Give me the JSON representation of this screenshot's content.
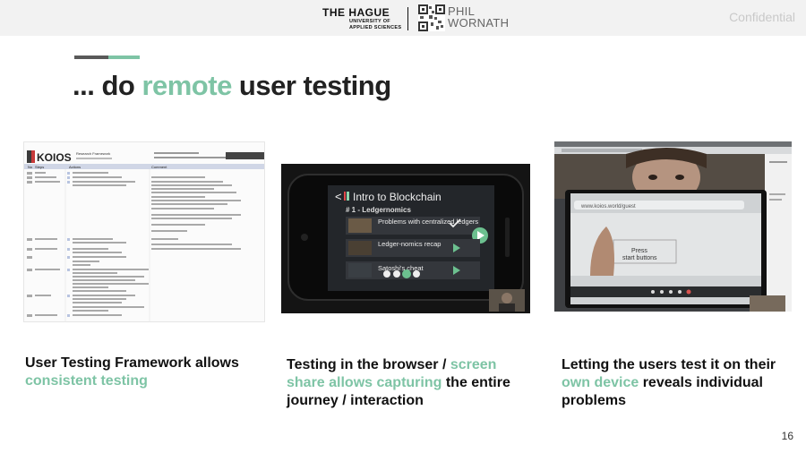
{
  "header": {
    "hague_line1": "THE HAGUE",
    "hague_line2": "UNIVERSITY OF",
    "hague_line3": "APPLIED SCIENCES",
    "phil_line1": "PHIL",
    "phil_line2": "WORNATH",
    "confidential": "Confidential"
  },
  "title": {
    "prefix": "... do ",
    "highlight": "remote",
    "suffix": " user testing"
  },
  "panels": [
    {
      "caption_part1": "User Testing Framework allows ",
      "caption_highlight": "consistent testing",
      "caption_part2": "",
      "screen": {
        "app_name": "KOIOS",
        "doc_title": "Research Framework",
        "header_cols": [
          "No",
          "Steps",
          "Actions",
          "Comment"
        ]
      }
    },
    {
      "caption_part1": "Testing in the browser / ",
      "caption_highlight": "screen share allows capturing",
      "caption_part2": " the entire journey / interaction",
      "screen": {
        "course_title": "Intro to Blockchain",
        "lesson_heading": "# 1 - Ledgernomics",
        "items": [
          "Problems with centralized ledgers",
          "Ledger-nomics recap",
          "Satoshi's cheat"
        ]
      }
    },
    {
      "caption_part1": "Letting the users test it on their ",
      "caption_highlight": "own device",
      "caption_part2": " reveals individual problems",
      "screen": {
        "url_text": "www.koios.world/guest",
        "prompt_line1": "Press",
        "prompt_line2": "start buttons"
      }
    }
  ],
  "page_number": "16",
  "colors": {
    "accent": "#7ec4a5",
    "dark_bar": "#595959",
    "title": "#222222"
  }
}
